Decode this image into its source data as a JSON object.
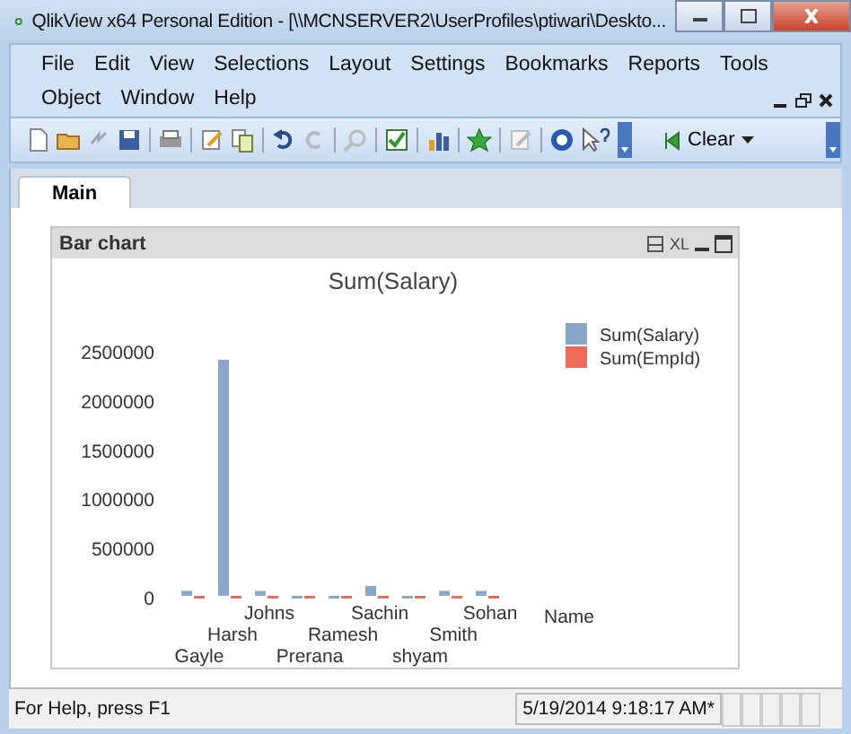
{
  "window": {
    "title": "QlikView x64 Personal Edition - [\\\\MCNSERVER2\\UserProfiles\\ptiwari\\Deskto..."
  },
  "menu": {
    "items": [
      "File",
      "Edit",
      "View",
      "Selections",
      "Layout",
      "Settings",
      "Bookmarks",
      "Reports",
      "Tools",
      "Object",
      "Window",
      "Help"
    ]
  },
  "toolbar": {
    "clear_button": "Clear"
  },
  "tabs": [
    {
      "label": "Main",
      "selected": true
    }
  ],
  "chart_box": {
    "caption": "Bar chart",
    "xl_label": "XL",
    "chart_data": {
      "type": "bar",
      "title": "Sum(Salary)",
      "xlabel": "Name",
      "categories": [
        "Gayle",
        "Harsh",
        "Johns",
        "Prerana",
        "Ramesh",
        "Sachin",
        "shyam",
        "Smith",
        "Sohan"
      ],
      "series": [
        {
          "name": "Sum(Salary)",
          "color": "#8aa6c9",
          "values": [
            50000,
            2400000,
            50000,
            0,
            0,
            100000,
            0,
            50000,
            50000
          ]
        },
        {
          "name": "Sum(EmpId)",
          "color": "#f06a5a",
          "values": [
            0,
            0,
            0,
            0,
            0,
            0,
            0,
            0,
            0
          ]
        }
      ],
      "legend": true,
      "ylim": [
        0,
        2500000
      ],
      "yticks": [
        0,
        500000,
        1000000,
        1500000,
        2000000,
        2500000
      ]
    }
  },
  "status_bar": {
    "help": "For Help, press F1",
    "timestamp": "5/19/2014 9:18:17 AM*"
  }
}
